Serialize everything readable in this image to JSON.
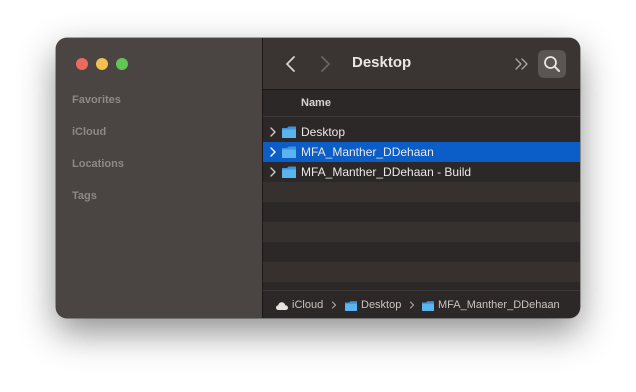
{
  "window": {
    "title": "Desktop",
    "controls": {
      "close_color": "#ec6a5e",
      "minimize_color": "#f4bf4f",
      "maximize_color": "#61c554"
    }
  },
  "sidebar": {
    "sections": [
      "Favorites",
      "iCloud",
      "Locations",
      "Tags"
    ]
  },
  "toolbar": {
    "title": "Desktop",
    "icons": [
      "chevron-left-icon",
      "chevron-right-icon",
      "double-chevron-right-icon",
      "search-icon"
    ]
  },
  "list": {
    "column_header": "Name",
    "items": [
      {
        "label": "Desktop",
        "icon": "folder-icon",
        "selected": false
      },
      {
        "label": "MFA_Manther_DDehaan",
        "icon": "folder-icon",
        "selected": true
      },
      {
        "label": "MFA_Manther_DDehaan - Build",
        "icon": "folder-icon",
        "selected": false
      }
    ]
  },
  "pathbar": {
    "crumbs": [
      {
        "label": "iCloud",
        "icon": "cloud-icon"
      },
      {
        "label": "Desktop",
        "icon": "folder-icon"
      },
      {
        "label": "MFA_Manther_DDehaan",
        "icon": "folder-icon"
      }
    ]
  },
  "colors": {
    "selection": "#0b5dc7",
    "folder": "#4aa7e8"
  }
}
